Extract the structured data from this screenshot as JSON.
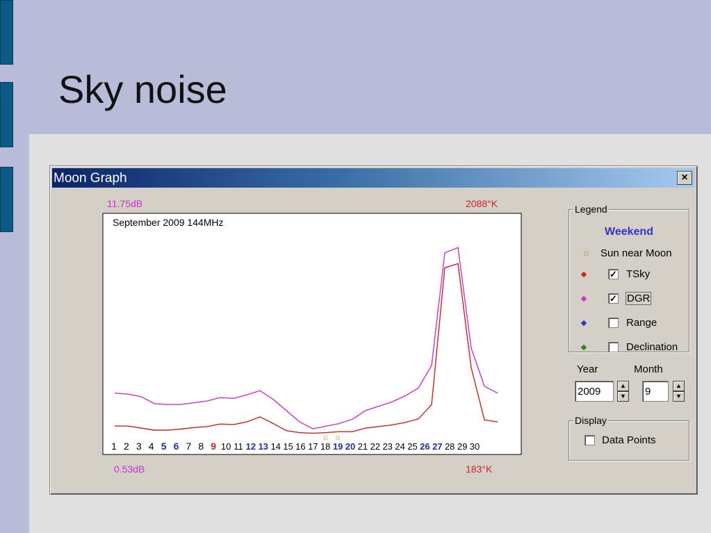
{
  "slide": {
    "title": "Sky noise"
  },
  "window": {
    "title": "Moon Graph",
    "close_label": "×"
  },
  "chart_data": {
    "type": "line",
    "title": "September 2009 144MHz",
    "left_axis": {
      "max_label": "11.75dB",
      "min_label": "0.53dB",
      "ylim": [
        0.53,
        11.75
      ]
    },
    "right_axis": {
      "max_label": "2088°K",
      "min_label": "183°K",
      "ylim": [
        183,
        2088
      ]
    },
    "x": [
      1,
      2,
      3,
      4,
      5,
      6,
      7,
      8,
      9,
      10,
      11,
      12,
      13,
      14,
      15,
      16,
      17,
      18,
      19,
      20,
      21,
      22,
      23,
      24,
      25,
      26,
      27,
      28,
      29,
      30
    ],
    "x_labels": [
      {
        "text": "1",
        "style": "normal"
      },
      {
        "text": "2",
        "style": "normal"
      },
      {
        "text": "3",
        "style": "normal"
      },
      {
        "text": "4",
        "style": "normal"
      },
      {
        "text": "5",
        "style": "weekend"
      },
      {
        "text": "6",
        "style": "weekend"
      },
      {
        "text": "7",
        "style": "normal"
      },
      {
        "text": "8",
        "style": "normal"
      },
      {
        "text": "9",
        "style": "holiday"
      },
      {
        "text": "10",
        "style": "normal"
      },
      {
        "text": "11",
        "style": "normal"
      },
      {
        "text": "12",
        "style": "weekend"
      },
      {
        "text": "13",
        "style": "weekend"
      },
      {
        "text": "14",
        "style": "normal"
      },
      {
        "text": "15",
        "style": "normal"
      },
      {
        "text": "16",
        "style": "normal"
      },
      {
        "text": "17",
        "style": "normal"
      },
      {
        "text": "18",
        "style": "normal"
      },
      {
        "text": "19",
        "style": "weekend"
      },
      {
        "text": "20",
        "style": "weekend"
      },
      {
        "text": "21",
        "style": "normal"
      },
      {
        "text": "22",
        "style": "normal"
      },
      {
        "text": "23",
        "style": "normal"
      },
      {
        "text": "24",
        "style": "normal"
      },
      {
        "text": "25",
        "style": "normal"
      },
      {
        "text": "26",
        "style": "weekend"
      },
      {
        "text": "27",
        "style": "weekend"
      },
      {
        "text": "28",
        "style": "normal"
      },
      {
        "text": "29",
        "style": "normal"
      },
      {
        "text": "30",
        "style": "normal"
      }
    ],
    "sun_near_moon_days": [
      18,
      19
    ],
    "series": [
      {
        "name": "TSky",
        "color": "#cc2222",
        "values": [
          230,
          230,
          210,
          190,
          190,
          200,
          215,
          225,
          250,
          245,
          270,
          320,
          255,
          185,
          165,
          160,
          165,
          175,
          175,
          210,
          225,
          240,
          265,
          300,
          440,
          1780,
          1820,
          800,
          290,
          270
        ]
      },
      {
        "name": "DGR",
        "color": "#cc33cc",
        "values": [
          2.7,
          2.65,
          2.5,
          2.1,
          2.05,
          2.05,
          2.15,
          2.25,
          2.45,
          2.4,
          2.6,
          2.85,
          2.35,
          1.7,
          1.05,
          0.65,
          0.8,
          0.95,
          1.2,
          1.7,
          1.95,
          2.2,
          2.55,
          3.0,
          4.3,
          10.8,
          11.1,
          5.3,
          3.1,
          2.7
        ]
      }
    ],
    "weekend_color": "#1a2fb0",
    "holiday_color": "#cc2222",
    "left_label_color": "#cc33cc",
    "right_label_color": "#cc2222"
  },
  "legend": {
    "group_label": "Legend",
    "weekend_label": "Weekend",
    "sun_label": "Sun near Moon",
    "items": [
      {
        "label": "TSky",
        "color": "#cc2222",
        "checked": true
      },
      {
        "label": "DGR",
        "color": "#cc33cc",
        "checked": true
      },
      {
        "label": "Range",
        "color": "#3333cc",
        "checked": false
      },
      {
        "label": "Declination",
        "color": "#228822",
        "checked": false
      }
    ]
  },
  "controls": {
    "year_label": "Year",
    "month_label": "Month",
    "year_value": "2009",
    "month_value": "9",
    "spin_up": "▲",
    "spin_down": "▼"
  },
  "display": {
    "group_label": "Display",
    "data_points_label": "Data Points",
    "data_points_checked": false
  }
}
